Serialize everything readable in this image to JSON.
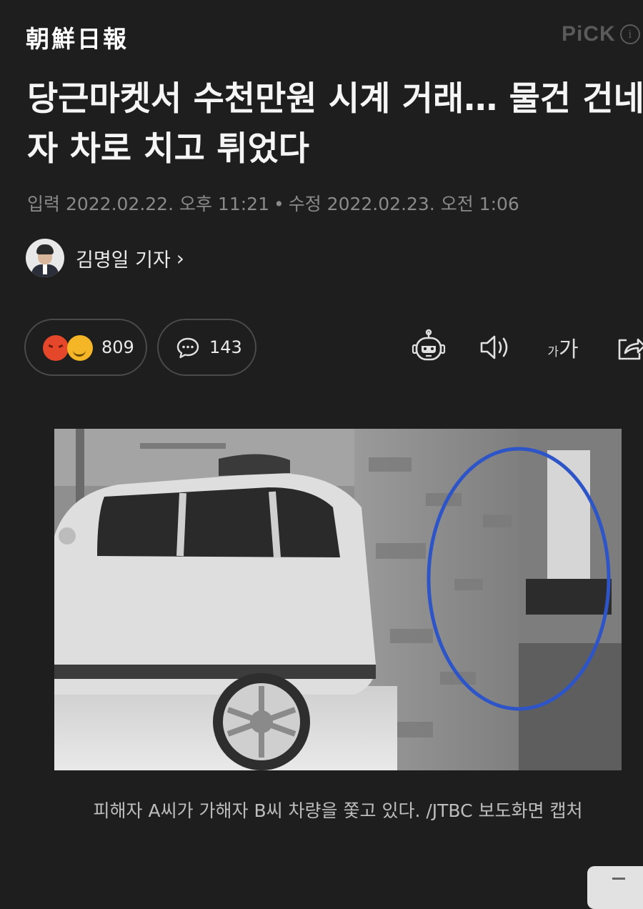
{
  "masthead": {
    "logo": "朝鮮日報",
    "pick_label": "PiCK",
    "info_glyph": "i"
  },
  "article": {
    "headline": "당근마켓서 수천만원 시계 거래… 물건 건네자 차로 치고 튀었다",
    "published": "입력 2022.02.22. 오후 11:21",
    "separator": "•",
    "modified": "수정 2022.02.23. 오전 1:06",
    "author": "김명일 기자",
    "author_chevron": "›"
  },
  "engagement": {
    "reaction_count": "809",
    "comment_count": "143",
    "reaction_icons": [
      "angry-emoji-icon",
      "smile-emoji-icon"
    ],
    "comment_icon": "speech-bubble-icon"
  },
  "toolbar": {
    "icons": [
      "robot-summary-icon",
      "speaker-icon",
      "font-size-icon",
      "share-icon"
    ],
    "font_small": "가",
    "font_large": "가"
  },
  "photo": {
    "caption": "피해자 A씨가 가해자 B씨 차량을 쫓고 있다. /JTBC 보도화면 캡처",
    "highlight_color": "#2e55c8"
  },
  "colors": {
    "background": "#1e1e1e",
    "text": "#f2f2f2",
    "muted": "#8a8a8a",
    "pill_border": "#4a4a4a"
  }
}
